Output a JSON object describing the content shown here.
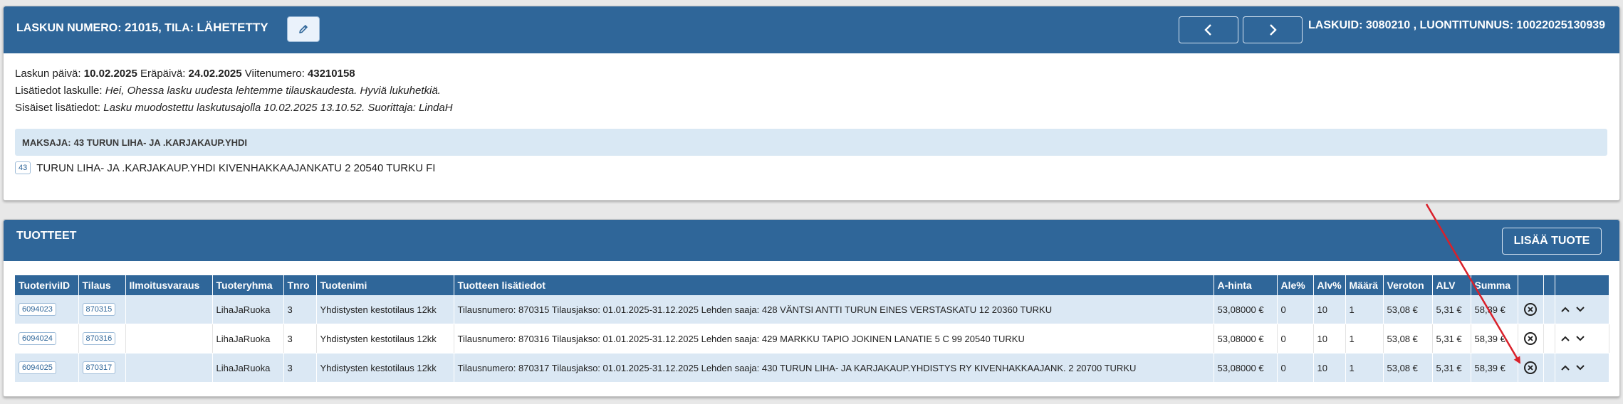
{
  "invoice": {
    "title_prefix": "LASKUN NUMERO:",
    "number": "21015",
    "status_prefix": ", TILA:",
    "status": "LÄHETETTY",
    "right_info": "LASKUID: 3080210 , LUONTITUNNUS: 10022025130939",
    "date_label": "Laskun päivä:",
    "date": "10.02.2025",
    "due_label": "Eräpäivä:",
    "due": "24.02.2025",
    "ref_label": "Viitenumero:",
    "ref": "43210158",
    "info_label": "Lisätiedot laskulle:",
    "info": "Hei, Ohessa lasku uudesta lehtemme tilauskaudesta. Hyviä lukuhetkiä.",
    "internal_label": "Sisäiset lisätiedot:",
    "internal": "Lasku muodostettu laskutusajolla 10.02.2025 13.10.52. Suorittaja: LindaH",
    "payer_label": "MAKSAJA:",
    "payer": "43 TURUN LIHA- JA .KARJAKAUP.YHDI",
    "payer_tag": "43",
    "payer_address": "TURUN LIHA- JA .KARJAKAUP.YHDI KIVENHAKKAAJANKATU 2 20540 TURKU FI"
  },
  "products": {
    "title": "TUOTTEET",
    "add_label": "LISÄÄ TUOTE",
    "columns": [
      "TuoteriviID",
      "Tilaus",
      "Ilmoitusvaraus",
      "Tuoteryhma",
      "Tnro",
      "Tuotenimi",
      "Tuotteen lisätiedot",
      "A-hinta",
      "Ale%",
      "Alv%",
      "Määrä",
      "Veroton",
      "ALV",
      "Summa",
      "",
      "",
      ""
    ],
    "rows": [
      {
        "id": "6094023",
        "order": "870315",
        "reservation": "",
        "group": "LihaJaRuoka",
        "tnro": "3",
        "name": "Yhdistysten kestotilaus 12kk",
        "details": "Tilausnumero: 870315 Tilausjakso: 01.01.2025-31.12.2025 Lehden saaja: 428 VÄNTSI ANTTI TURUN EINES VERSTASKATU 12 20360 TURKU",
        "price": "53,08000 €",
        "discount": "0",
        "vat_pct": "10",
        "qty": "1",
        "net": "53,08 €",
        "vat": "5,31 €",
        "sum": "58,39 €"
      },
      {
        "id": "6094024",
        "order": "870316",
        "reservation": "",
        "group": "LihaJaRuoka",
        "tnro": "3",
        "name": "Yhdistysten kestotilaus 12kk",
        "details": "Tilausnumero: 870316 Tilausjakso: 01.01.2025-31.12.2025 Lehden saaja: 429 MARKKU TAPIO JOKINEN LANATIE 5 C 99 20540 TURKU",
        "price": "53,08000 €",
        "discount": "0",
        "vat_pct": "10",
        "qty": "1",
        "net": "53,08 €",
        "vat": "5,31 €",
        "sum": "58,39 €"
      },
      {
        "id": "6094025",
        "order": "870317",
        "reservation": "",
        "group": "LihaJaRuoka",
        "tnro": "3",
        "name": "Yhdistysten kestotilaus 12kk",
        "details": "Tilausnumero: 870317 Tilausjakso: 01.01.2025-31.12.2025 Lehden saaja: 430 TURUN LIHA- JA KARJAKAUP.YHDISTYS RY KIVENHAKKAAJANK. 2 20700 TURKU",
        "price": "53,08000 €",
        "discount": "0",
        "vat_pct": "10",
        "qty": "1",
        "net": "53,08 €",
        "vat": "5,31 €",
        "sum": "58,39 €"
      }
    ]
  },
  "icons": {
    "edit": "pencil-icon",
    "prev": "chevron-left-icon",
    "next": "chevron-right-icon",
    "delete": "circle-x-icon",
    "up": "chevron-up-icon",
    "down": "chevron-down-icon",
    "annotation": "red-arrow-annotation"
  },
  "colors": {
    "header_blue": "#2f6699",
    "row_light_blue": "#dbe8f4",
    "payer_bar": "#d9e8f4",
    "annotation_red": "#d9202a"
  }
}
